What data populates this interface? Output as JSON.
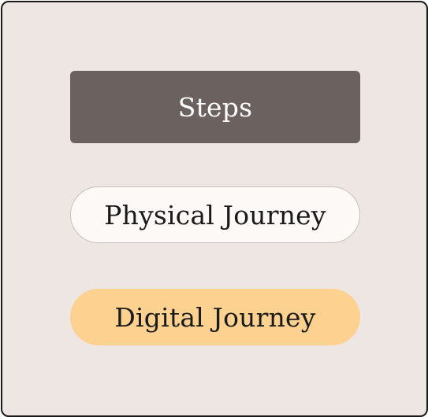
{
  "diagram": {
    "nodes": [
      {
        "id": "steps",
        "label": "Steps",
        "color": "#6b6260",
        "text_color": "#ffffff",
        "shape": "rounded-rectangle"
      },
      {
        "id": "physical",
        "label": "Physical Journey",
        "color": "#fdf9f6",
        "text_color": "#1a1a1a",
        "shape": "pill"
      },
      {
        "id": "digital",
        "label": "Digital Journey",
        "color": "#fdd18f",
        "text_color": "#1a1a1a",
        "shape": "pill"
      }
    ],
    "background": "#ede6e2",
    "border_color": "#1a1a1a"
  }
}
